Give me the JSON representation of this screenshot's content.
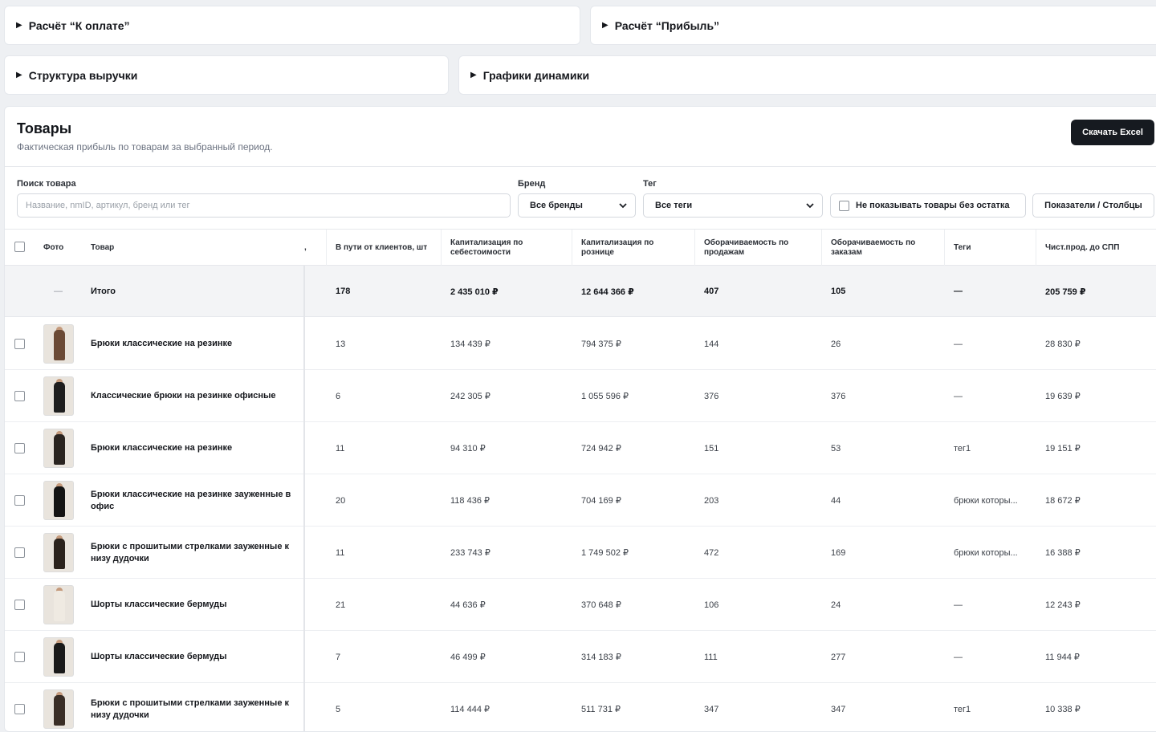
{
  "accordions": [
    {
      "label": "Расчёт “К оплате”"
    },
    {
      "label": "Расчёт “Прибыль”"
    },
    {
      "label": "Структура выручки"
    },
    {
      "label": "Графики динамики"
    }
  ],
  "products": {
    "title": "Товары",
    "subtitle": "Фактическая прибыль по товарам за выбранный период.",
    "excel_button": "Скачать Excel"
  },
  "filters": {
    "search_label": "Поиск товара",
    "search_placeholder": "Название, nmID, артикул, бренд или тег",
    "brand_label": "Бренд",
    "brand_value": "Все бренды",
    "tag_label": "Тег",
    "tag_value": "Все теги",
    "hide_empty_label": "Не показывать товары без остатка",
    "columns_button": "Показатели / Столбцы"
  },
  "table": {
    "headers": {
      "photo": "Фото",
      "product": "Товар",
      "partial": ",",
      "in_transit": "В пути от клиентов, шт",
      "cap_cost": "Капитализация по себестоимости",
      "cap_retail": "Капитализация по рознице",
      "turn_sales": "Оборачиваемость по продажам",
      "turn_orders": "Оборачиваемость по заказам",
      "tags": "Теги",
      "net_sales": "Чист.прод. до СПП"
    },
    "total": {
      "photo": "—",
      "name": "Итого",
      "in_transit": "178",
      "cap_cost": "2 435 010 ₽",
      "cap_retail": "12 644 366 ₽",
      "turn_sales": "407",
      "turn_orders": "105",
      "tags": "—",
      "net_sales": "205 759 ₽"
    },
    "rows": [
      {
        "name": "Брюки классические на резинке",
        "in_transit": "13",
        "cap_cost": "134 439 ₽",
        "cap_retail": "794 375 ₽",
        "turn_sales": "144",
        "turn_orders": "26",
        "tags": "—",
        "net_sales": "28 830 ₽",
        "color": "#6b4a36"
      },
      {
        "name": "Классические брюки на резинке офисные",
        "in_transit": "6",
        "cap_cost": "242 305 ₽",
        "cap_retail": "1 055 596 ₽",
        "turn_sales": "376",
        "turn_orders": "376",
        "tags": "—",
        "net_sales": "19 639 ₽",
        "color": "#1e1e1e"
      },
      {
        "name": "Брюки классические на резинке",
        "in_transit": "11",
        "cap_cost": "94 310 ₽",
        "cap_retail": "724 942 ₽",
        "turn_sales": "151",
        "turn_orders": "53",
        "tags": "тег1",
        "net_sales": "19 151 ₽",
        "color": "#2a2420"
      },
      {
        "name": "Брюки классические на резинке зауженные в офис",
        "in_transit": "20",
        "cap_cost": "118 436 ₽",
        "cap_retail": "704 169 ₽",
        "turn_sales": "203",
        "turn_orders": "44",
        "tags": "брюки которы...",
        "net_sales": "18 672 ₽",
        "color": "#141414"
      },
      {
        "name": "Брюки с прошитыми стрелками зауженные к низу дудочки",
        "in_transit": "11",
        "cap_cost": "233 743 ₽",
        "cap_retail": "1 749 502 ₽",
        "turn_sales": "472",
        "turn_orders": "169",
        "tags": "брюки которы...",
        "net_sales": "16 388 ₽",
        "color": "#2b231d"
      },
      {
        "name": "Шорты классические бермуды",
        "in_transit": "21",
        "cap_cost": "44 636 ₽",
        "cap_retail": "370 648 ₽",
        "turn_sales": "106",
        "turn_orders": "24",
        "tags": "—",
        "net_sales": "12 243 ₽",
        "color": "#efeae2"
      },
      {
        "name": "Шорты классические бермуды",
        "in_transit": "7",
        "cap_cost": "46 499 ₽",
        "cap_retail": "314 183 ₽",
        "turn_sales": "111",
        "turn_orders": "277",
        "tags": "—",
        "net_sales": "11 944 ₽",
        "color": "#1a1a1a"
      },
      {
        "name": "Брюки с прошитыми стрелками зауженные к низу дудочки",
        "in_transit": "5",
        "cap_cost": "114 444 ₽",
        "cap_retail": "511 731 ₽",
        "turn_sales": "347",
        "turn_orders": "347",
        "tags": "тег1",
        "net_sales": "10 338 ₽",
        "color": "#3a2e26"
      }
    ]
  }
}
